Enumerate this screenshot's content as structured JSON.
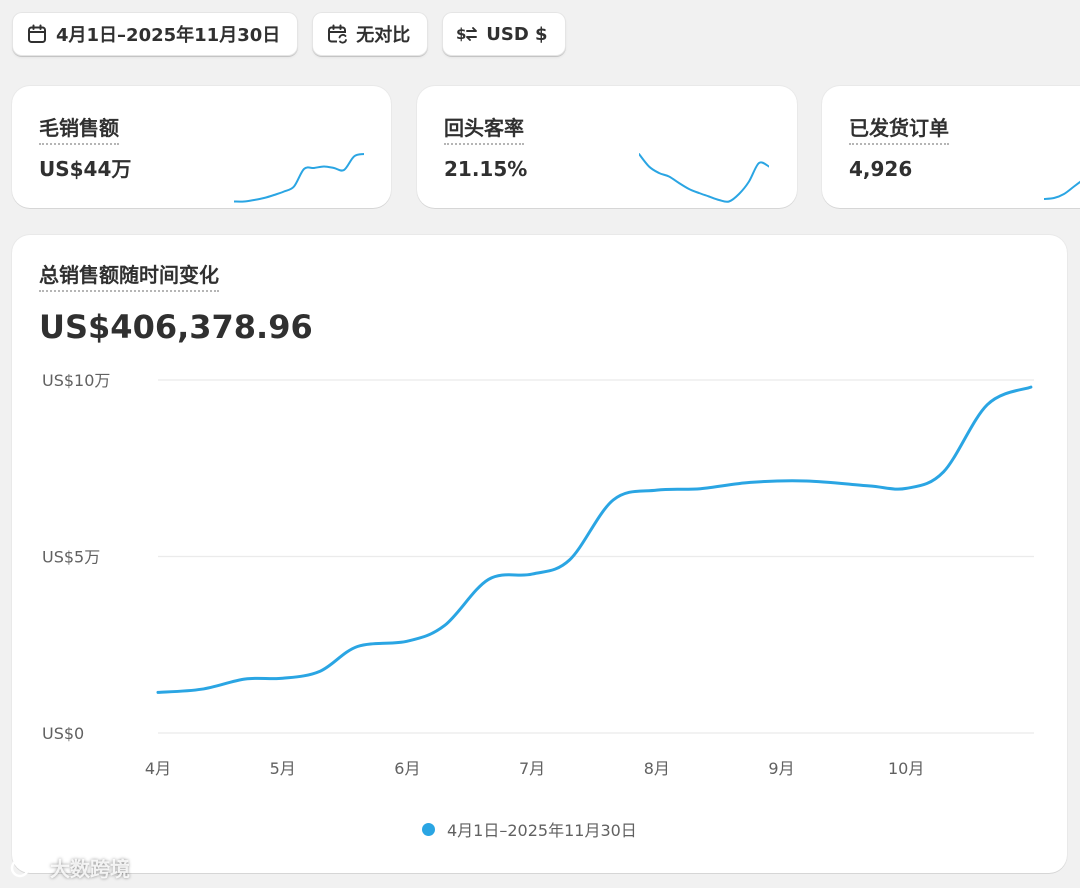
{
  "toolbar": {
    "date_range": "4月1日–2025年11月30日",
    "comparison": "无对比",
    "currency": "USD $"
  },
  "metrics": [
    {
      "title": "毛销售额",
      "value": "US$44万"
    },
    {
      "title": "回头客率",
      "value": "21.15%"
    },
    {
      "title": "已发货订单",
      "value": "4,926"
    }
  ],
  "main": {
    "title": "总销售额随时间变化",
    "total": "US$406,378.96"
  },
  "watermark": "大数跨境",
  "colors": {
    "accent": "#2aa5e3",
    "grid": "#ebebeb",
    "label": "#616161"
  },
  "chart_data": {
    "type": "line",
    "yticks": [
      {
        "value": 0,
        "label": "US$0"
      },
      {
        "value": 50000,
        "label": "US$5万"
      },
      {
        "value": 100000,
        "label": "US$10万"
      }
    ],
    "ylim": [
      0,
      100000
    ],
    "xticks": [
      "4月",
      "5月",
      "6月",
      "7月",
      "8月",
      "9月",
      "10月"
    ],
    "grid": true,
    "legend_position": "bottom",
    "series": [
      {
        "name": "4月1日–2025年11月30日",
        "points": [
          {
            "x": 0,
            "y": 11500
          },
          {
            "x": 0.35,
            "y": 12400
          },
          {
            "x": 0.7,
            "y": 15300
          },
          {
            "x": 1.0,
            "y": 15500
          },
          {
            "x": 1.3,
            "y": 17500
          },
          {
            "x": 1.6,
            "y": 24500
          },
          {
            "x": 2.0,
            "y": 26000
          },
          {
            "x": 2.3,
            "y": 30500
          },
          {
            "x": 2.65,
            "y": 43500
          },
          {
            "x": 3.0,
            "y": 45000
          },
          {
            "x": 3.3,
            "y": 49000
          },
          {
            "x": 3.65,
            "y": 66000
          },
          {
            "x": 4.0,
            "y": 68800
          },
          {
            "x": 4.35,
            "y": 69200
          },
          {
            "x": 4.75,
            "y": 71000
          },
          {
            "x": 5.2,
            "y": 71400
          },
          {
            "x": 5.7,
            "y": 70000
          },
          {
            "x": 6.0,
            "y": 69300
          },
          {
            "x": 6.3,
            "y": 74000
          },
          {
            "x": 6.65,
            "y": 93000
          },
          {
            "x": 7.0,
            "y": 98000
          }
        ]
      }
    ]
  },
  "sparklines": [
    [
      0.05,
      0.05,
      0.08,
      0.12,
      0.18,
      0.25,
      0.35,
      0.7,
      0.72,
      0.75,
      0.72,
      0.68,
      0.95,
      1.0
    ],
    [
      1.0,
      0.75,
      0.62,
      0.55,
      0.42,
      0.3,
      0.22,
      0.15,
      0.08,
      0.05,
      0.2,
      0.45,
      0.82,
      0.75
    ],
    [
      0.1,
      0.12,
      0.2,
      0.35,
      0.5
    ]
  ]
}
